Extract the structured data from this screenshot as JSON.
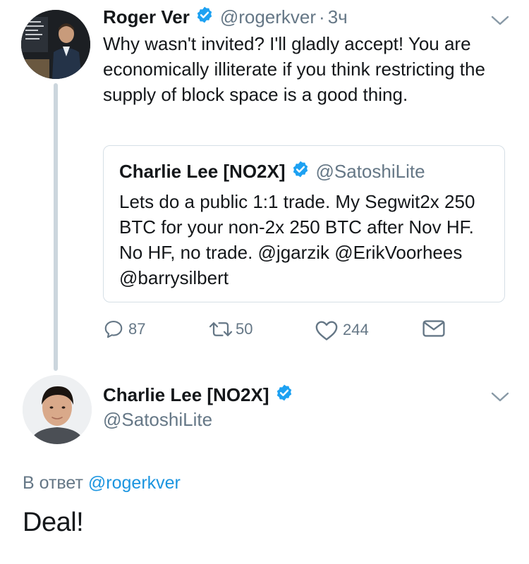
{
  "tweet1": {
    "author": {
      "name": "Roger Ver",
      "handle": "@rogerkver",
      "time": "3ч",
      "avatar_icon": "profile-photo-roger-ver"
    },
    "text": "Why wasn't invited?  I'll gladly accept! You are economically illiterate if you think restricting the supply of block space is a good thing.",
    "quoted": {
      "author": {
        "name": "Charlie Lee [NO2X]",
        "handle": "@SatoshiLite"
      },
      "text": "Lets do a public 1:1 trade. My Segwit2x 250 BTC for your non-2x 250 BTC after Nov HF. No HF, no trade. @jgarzik @ErikVoorhees @barrysilbert"
    },
    "actions": {
      "replies": "87",
      "retweets": "50",
      "likes": "244"
    }
  },
  "tweet2": {
    "author": {
      "name": "Charlie Lee [NO2X]",
      "handle": "@SatoshiLite",
      "avatar_icon": "profile-photo-charlie-lee"
    },
    "reply_to_label": "В ответ",
    "reply_to_handle": "@rogerkver",
    "text": "Deal!"
  },
  "colors": {
    "verified": "#1da1f2",
    "link": "#1b95e0",
    "muted": "#657786"
  }
}
